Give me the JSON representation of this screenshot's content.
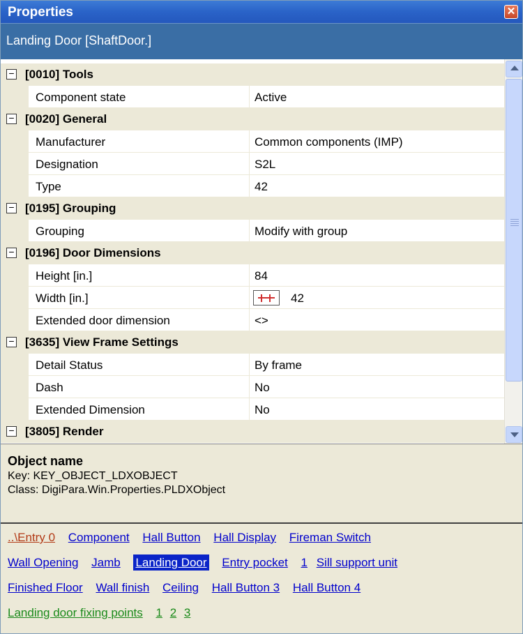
{
  "window": {
    "title": "Properties"
  },
  "subheader": {
    "text": "Landing Door [ShaftDoor.]"
  },
  "categories": [
    {
      "label": "[0010] Tools",
      "props": [
        {
          "name": "Component state",
          "value": "Active"
        }
      ]
    },
    {
      "label": "[0020] General",
      "props": [
        {
          "name": "Manufacturer",
          "value": "Common components (IMP)"
        },
        {
          "name": "Designation",
          "value": "S2L"
        },
        {
          "name": "Type",
          "value": "42"
        }
      ]
    },
    {
      "label": "[0195] Grouping",
      "props": [
        {
          "name": "Grouping",
          "value": "Modify with group"
        }
      ]
    },
    {
      "label": "[0196] Door Dimensions",
      "props": [
        {
          "name": "Height [in.]",
          "value": "84"
        },
        {
          "name": "Width [in.]",
          "value": "42"
        },
        {
          "name": "Extended door dimension",
          "value": "<>"
        }
      ]
    },
    {
      "label": "[3635] View Frame Settings",
      "props": [
        {
          "name": "Detail Status",
          "value": "By frame"
        },
        {
          "name": "Dash",
          "value": "No"
        },
        {
          "name": "Extended Dimension",
          "value": "No"
        }
      ]
    },
    {
      "label": "[3805] Render",
      "props": []
    }
  ],
  "object_info": {
    "title": "Object name",
    "key": "Key: KEY_OBJECT_LDXOBJECT",
    "class": "Class:  DigiPara.Win.Properties.PLDXObject"
  },
  "links": {
    "row1": [
      "..\\Entry 0",
      "Component",
      "Hall Button",
      "Hall Display",
      "Fireman Switch"
    ],
    "row2": [
      "Wall Opening",
      "Jamb",
      "Landing Door",
      "Entry pocket",
      "1",
      "Sill support unit"
    ],
    "row3": [
      "Finished Floor",
      "Wall finish",
      "Ceiling",
      "Hall Button 3",
      "Hall Button 4"
    ],
    "row4": [
      "Landing door fixing points",
      "1",
      "2",
      "3"
    ]
  },
  "icons": {
    "close": "close-icon",
    "collapse": "minus-box-icon",
    "dimension_edit": "dimension-edit-icon"
  },
  "colors": {
    "title_bar": "#2a63c8",
    "subheader": "#3a6ea5",
    "link": "#0000cc",
    "link_parent": "#b23a16",
    "link_fixing": "#1a8a1a",
    "selected_link": "#0a24c8"
  }
}
